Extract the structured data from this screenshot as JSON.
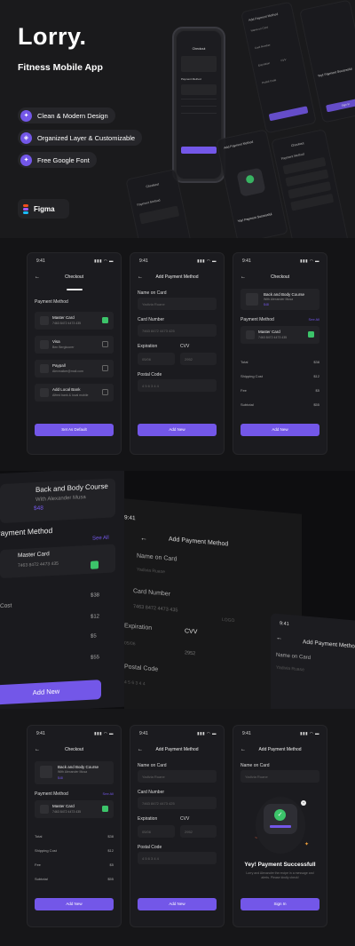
{
  "hero": {
    "brand": "Lorry.",
    "subtitle": "Fitness Mobile App",
    "features": [
      "Clean & Modern Design",
      "Organized Layer & Customizable",
      "Free Google Font"
    ],
    "figma_label": "Figma",
    "figma_colors": [
      "#f24e1e",
      "#a259ff",
      "#1abcfe",
      "#0acf83"
    ],
    "peek_yey": "Yey! Payment Successful",
    "peek_name_card": "Name on Card",
    "peek_card_number": "Card Number",
    "peek_expiration": "Expiration",
    "peek_cvv": "CVV",
    "peek_postal": "Postal Code",
    "peek_sign_in": "Sign In",
    "peek_checkout": "Checkout",
    "peek_add_payment": "Add Payment Method",
    "peek_payment_method": "Payment Method"
  },
  "status": {
    "time": "9:41",
    "signal": "▮▮▮ ◠ ▬"
  },
  "checkout_list": {
    "title": "Checkout",
    "section": "Payment Method",
    "cards": [
      {
        "name": "Master Card",
        "sub": "7463 8472 4473 435",
        "checked": true
      },
      {
        "name": "Visa",
        "sub": "Ben Bergkoorer",
        "checked": false
      },
      {
        "name": "Paypall",
        "sub": "Alexmaiker@mail.com",
        "checked": false
      },
      {
        "name": "Add Local Bank",
        "sub": "Alfred bank & local mobile",
        "checked": false
      }
    ],
    "button": "Set As Default"
  },
  "add_payment": {
    "title": "Add Payment Method",
    "name_label": "Name on Card",
    "name_placeholder": "Yadivia Ruane",
    "number_label": "Card Number",
    "number_value": "7463 8472 4473 425",
    "expiration_label": "Expiration",
    "cvv_label": "CVV",
    "expiration_value": "05/06",
    "cvv_value": "2952",
    "postal_label": "Postal Code",
    "postal_value": "4 5 6 3 4 4",
    "button": "Add New"
  },
  "checkout_summary": {
    "title": "Checkout",
    "course": "Back and Body Course",
    "course_by": "With Alexander Musa",
    "price": "$48",
    "section": "Payment Method",
    "see_all": "See All",
    "card_name": "Master Card",
    "card_number": "7463 8472 4473 435",
    "rows": [
      {
        "label": "Total",
        "value": "$38"
      },
      {
        "label": "Shipping Cost",
        "value": "$12"
      },
      {
        "label": "Fee",
        "value": "$5"
      },
      {
        "label": "Subtotal",
        "value": "$55"
      }
    ],
    "button": "Add New"
  },
  "zoom": {
    "course": "Back and Body Course",
    "course_by": "With Alexander Musa",
    "price": "$48",
    "section": "Payment Method",
    "see_all": "See All",
    "card_name": "Master Card",
    "card_number": "7463 8472 4473 435",
    "cost_label": "Cost",
    "values": [
      "$38",
      "$12",
      "$5",
      "$55"
    ],
    "button": "Add New",
    "time": "9:41",
    "title": "Add Payment Method",
    "name_label": "Name on Card",
    "name_value": "Yadivia Ruase",
    "number_label": "Card Number",
    "number_value": "7463 8472 4473 435",
    "logo": "LOGO",
    "expiration_label": "Expiration",
    "cvv_label": "CVV",
    "expiration_value": "05/06",
    "cvv_value": "2952",
    "postal_label": "Postal Code",
    "postal_value": "4 5 6 3 4 4",
    "right_name_value": "Yadivia Ruase"
  },
  "success": {
    "title": "Add Payment Method",
    "name_label": "Name on Card",
    "name_value": "Yadivia Ruane",
    "heading": "Yey! Payment Successfull",
    "message": "Lorry and Alexandre the recipe in a message and alerts. Please kindly check!",
    "button": "Sign In"
  },
  "colors": {
    "accent": "#7357e8",
    "success": "#3cc46a",
    "bg": "#141416"
  }
}
